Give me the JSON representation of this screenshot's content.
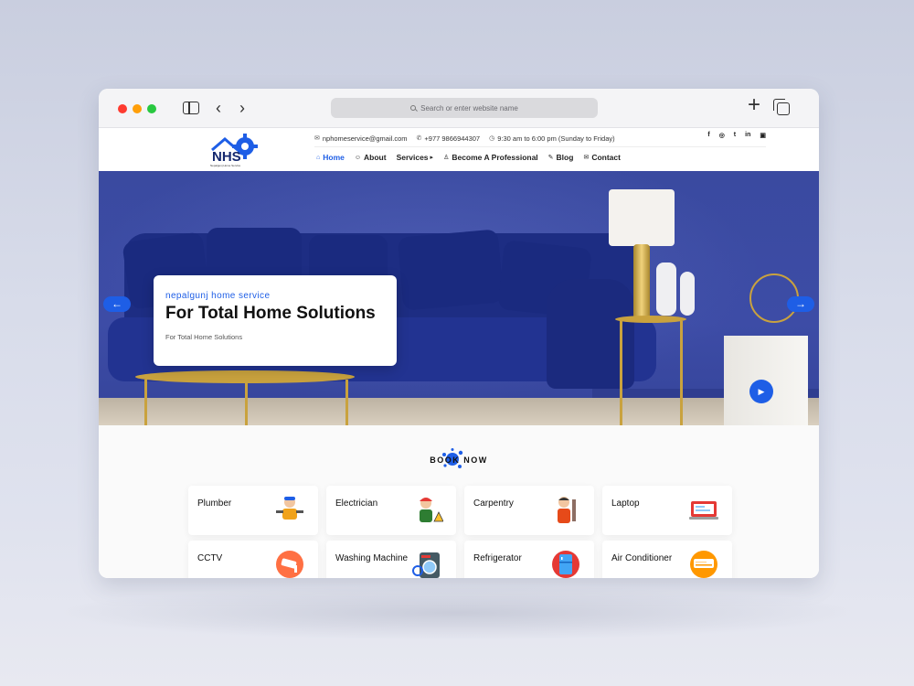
{
  "browser": {
    "url_placeholder": "Search or enter website name"
  },
  "site": {
    "logo_text": "NHS",
    "logo_tagline": "Nepalgunj Home Service",
    "contact": {
      "email": "nphomeservice@gmail.com",
      "phone": "+977 9866944307",
      "hours": "9:30 am to 6:00 pm (Sunday to Friday)"
    },
    "socials": [
      "f",
      "◎",
      "t",
      "in",
      "▣"
    ],
    "nav": [
      {
        "label": "Home",
        "icon": "⌂"
      },
      {
        "label": "About",
        "icon": "☺"
      },
      {
        "label": "Services",
        "icon": "▸"
      },
      {
        "label": "Become A Professional",
        "icon": "♙"
      },
      {
        "label": "Blog",
        "icon": "✎"
      },
      {
        "label": "Contact",
        "icon": "✉"
      }
    ]
  },
  "hero": {
    "subtitle": "nepalgunj home service",
    "title": "For Total Home Solutions",
    "description": "For Total Home Solutions",
    "prev_arrow": "←",
    "next_arrow": "→",
    "play": "▶"
  },
  "book": {
    "title": "BOOK NOW",
    "services": [
      "Plumber",
      "Electrician",
      "Carpentry",
      "Laptop",
      "CCTV",
      "Washing Machine",
      "Refrigerator",
      "Air Conditioner"
    ]
  },
  "colors": {
    "accent": "#1e5ee6",
    "hero_wall": "#3a4aa0",
    "sofa": "#1d2d83"
  }
}
